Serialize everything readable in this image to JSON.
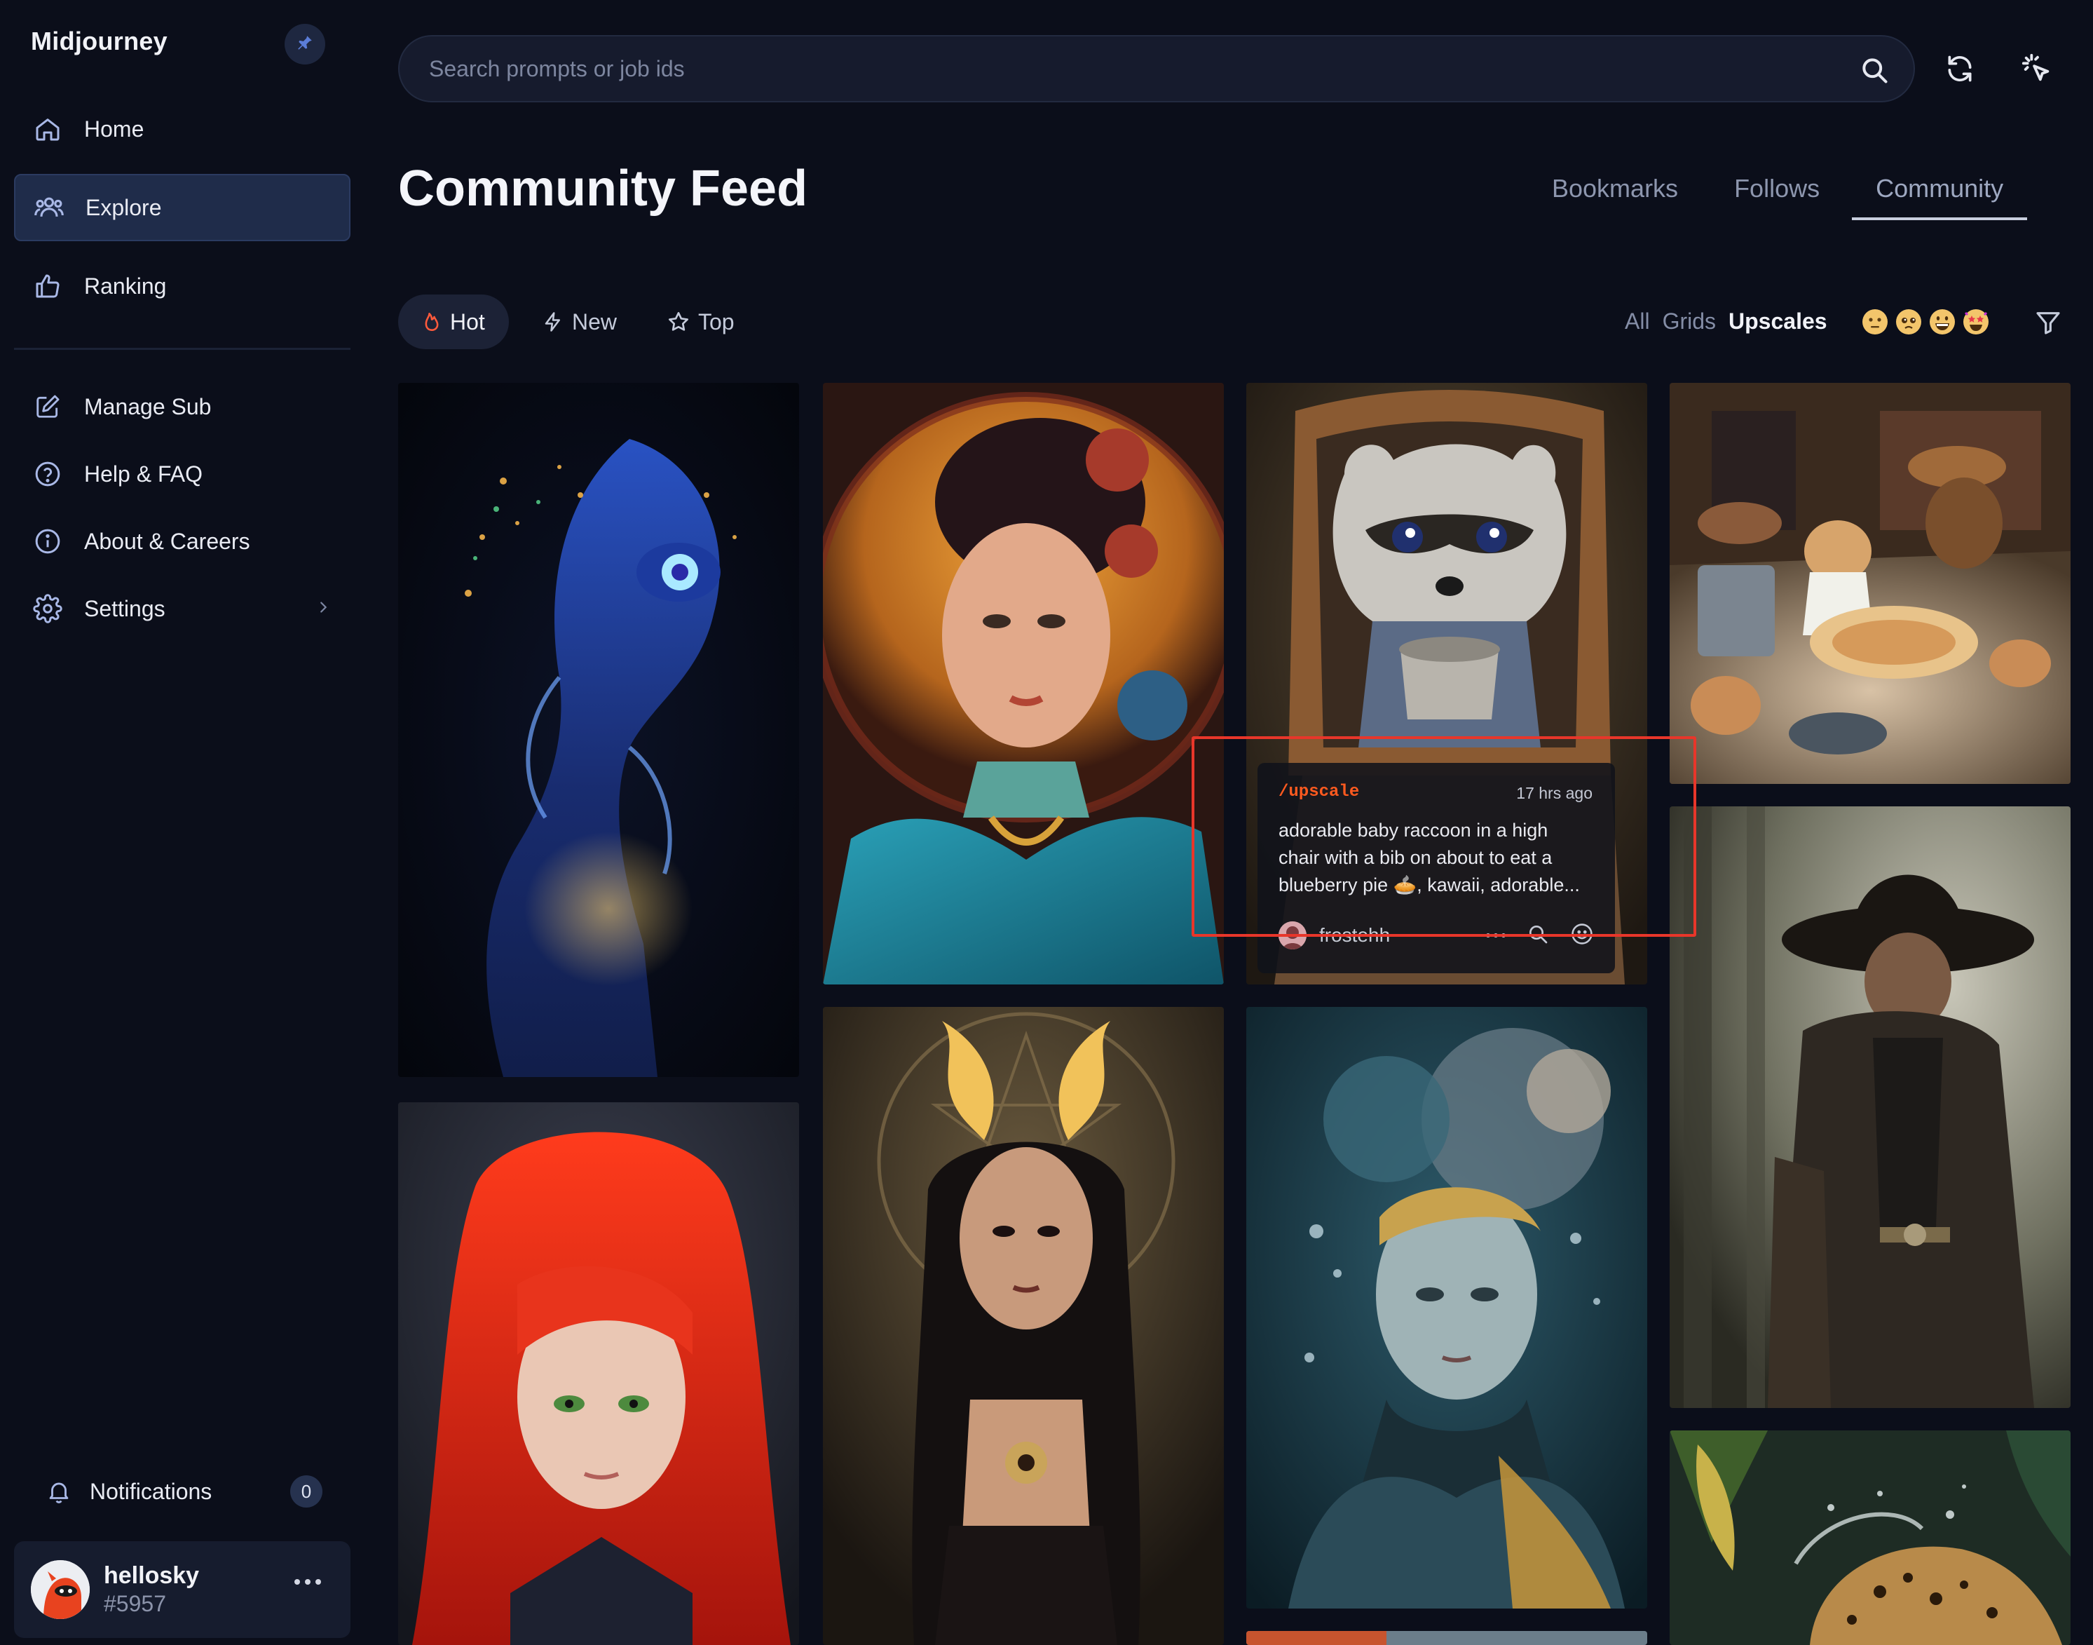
{
  "app": {
    "brand": "Midjourney"
  },
  "sidebar": {
    "items": [
      {
        "label": "Home",
        "icon": "home-icon"
      },
      {
        "label": "Explore",
        "icon": "people-icon",
        "active": true
      },
      {
        "label": "Ranking",
        "icon": "thumbs-up-icon"
      }
    ],
    "secondary": [
      {
        "label": "Manage Sub",
        "icon": "edit-icon"
      },
      {
        "label": "Help & FAQ",
        "icon": "help-icon"
      },
      {
        "label": "About & Careers",
        "icon": "info-icon"
      },
      {
        "label": "Settings",
        "icon": "gear-icon"
      }
    ],
    "notifications": {
      "label": "Notifications",
      "count": "0"
    },
    "user": {
      "name": "hellosky",
      "tag": "#5957"
    }
  },
  "search": {
    "placeholder": "Search prompts or job ids",
    "value": ""
  },
  "header": {
    "title": "Community Feed",
    "tabs": [
      "Bookmarks",
      "Follows",
      "Community"
    ],
    "active_tab": "Community"
  },
  "sort": {
    "options": [
      {
        "label": "Hot",
        "icon": "flame-icon",
        "active": true
      },
      {
        "label": "New",
        "icon": "bolt-icon"
      },
      {
        "label": "Top",
        "icon": "star-icon"
      }
    ]
  },
  "type_filter": {
    "options": [
      "All",
      "Grids",
      "Upscales"
    ],
    "active": "Upscales"
  },
  "emoji_filters": [
    "neutral-face",
    "pleading-face",
    "grinning-face",
    "star-struck-face"
  ],
  "hover_card": {
    "command": "/upscale",
    "time": "17 hrs ago",
    "prompt": "adorable baby raccoon in a high chair with a bib on about to eat a blueberry pie 🥧, kawaii, adorable...",
    "user": "frostehh"
  },
  "gallery": [
    {
      "name": "alien-creature"
    },
    {
      "name": "ornate-woman-portrait"
    },
    {
      "name": "raccoon-high-chair"
    },
    {
      "name": "cat-baker-diorama"
    },
    {
      "name": "cowboy-portrait"
    },
    {
      "name": "red-hair-girl"
    },
    {
      "name": "horned-witch"
    },
    {
      "name": "underwater-woman"
    },
    {
      "name": "leopard-splash"
    }
  ],
  "colors": {
    "accent": "#1f2c4a",
    "background": "#0b0e1a",
    "command": "#ff5a1f",
    "highlight": "#e8362a"
  }
}
